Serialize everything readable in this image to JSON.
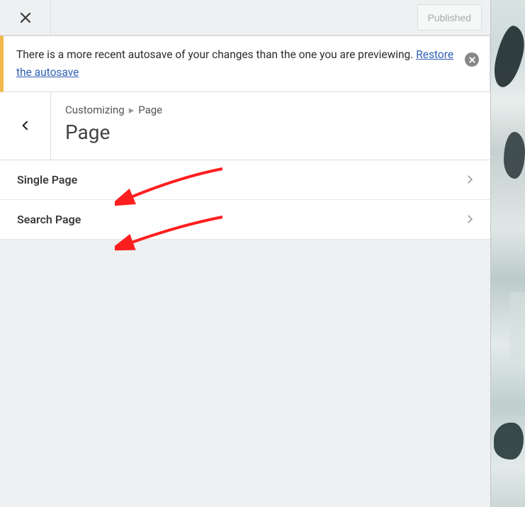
{
  "topbar": {
    "published_label": "Published"
  },
  "notice": {
    "text_before": "There is a more recent autosave of your changes than the one you are previewing. ",
    "link_text": "Restore the autosave"
  },
  "breadcrumb": {
    "root": "Customizing",
    "current": "Page"
  },
  "section": {
    "title": "Page"
  },
  "rows": [
    {
      "label": "Single Page"
    },
    {
      "label": "Search Page"
    }
  ]
}
